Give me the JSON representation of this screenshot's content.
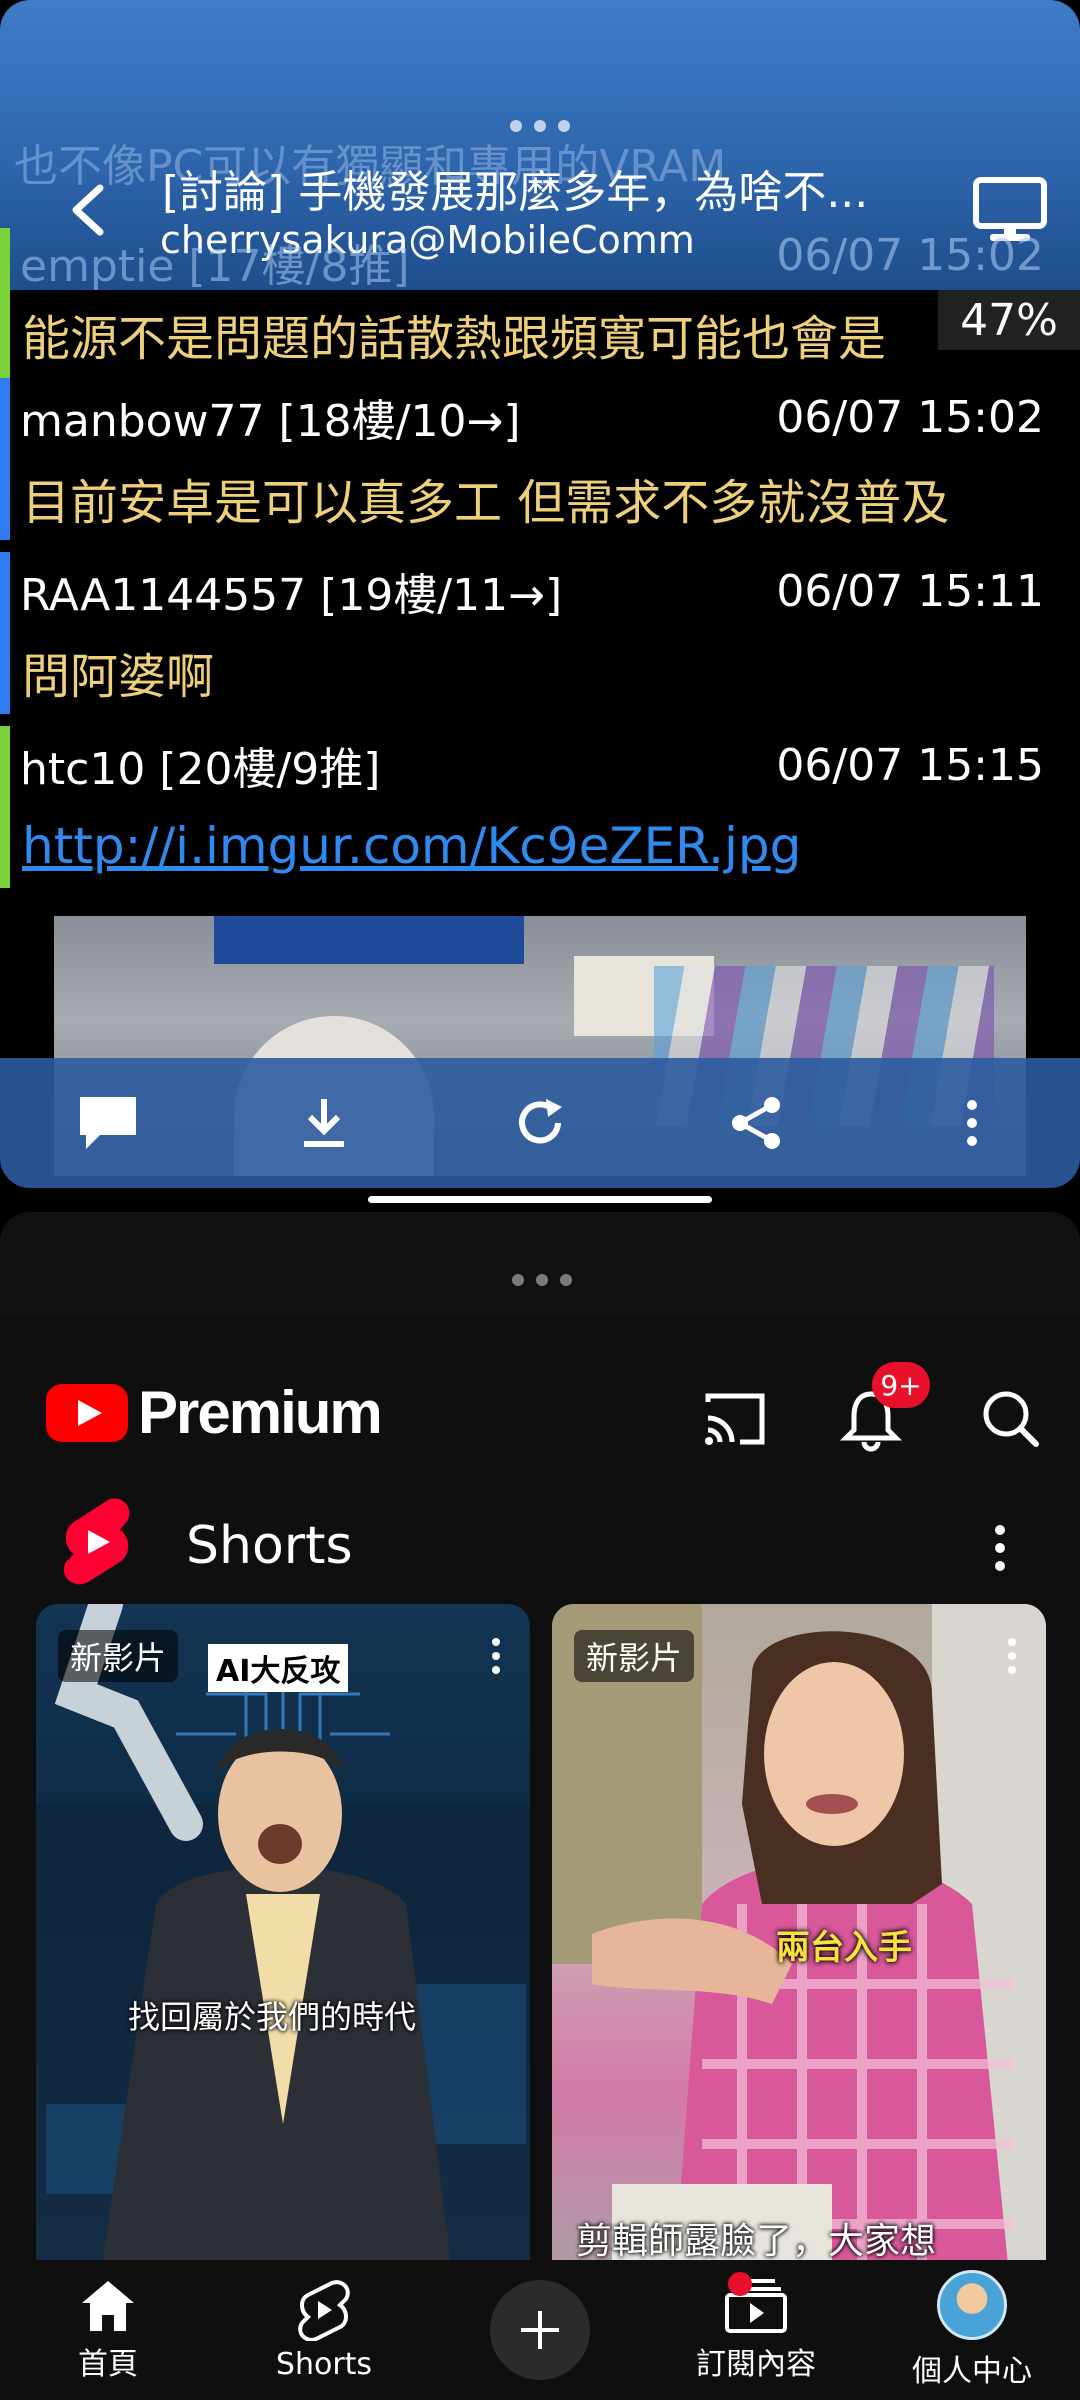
{
  "top_app": {
    "ghost_text": "也不像PC可以有獨顯和專用的VRAM",
    "thread_title": "[討論] 手機發展那麼多年，為啥不...",
    "thread_author": "cherrysakura@MobileComm",
    "progress": "47%",
    "overlay_row": {
      "meta": "emptie [17樓/8推]",
      "time": "06/07 15:02"
    },
    "first_body": "能源不是問題的話散熱跟頻寬可能也會是",
    "posts": [
      {
        "meta": "manbow77 [18樓/10→]",
        "time": "06/07 15:02",
        "body": "目前安卓是可以真多工  但需求不多就沒普及",
        "accent": "#2f7bf0"
      },
      {
        "meta": "RAA1144557 [19樓/11→]",
        "time": "06/07 15:11",
        "body": "問阿婆啊",
        "accent": "#2f7bf0"
      },
      {
        "meta": "htc10 [20樓/9推]",
        "time": "06/07 15:15",
        "body": "http://i.imgur.com/Kc9eZER.jpg",
        "accent": "#7bd33a"
      }
    ]
  },
  "youtube": {
    "brand": "Premium",
    "notification_count": "9+",
    "shelf_title": "Shorts",
    "shorts": [
      {
        "badge": "新影片",
        "tag": "AI大反攻",
        "caption": "找回屬於我們的時代"
      },
      {
        "badge": "新影片",
        "yellow_caption": "兩台入手",
        "caption": "剪輯師露臉了，大家想"
      }
    ],
    "nav": {
      "home": "首頁",
      "shorts": "Shorts",
      "subscriptions": "訂閱內容",
      "profile": "個人中心"
    }
  },
  "colors": {
    "header_blue": "#2f66ad",
    "post_body": "#efd07a",
    "link": "#2f8af0",
    "youtube_red": "#ff0000"
  },
  "icons": {
    "top_toolbar": [
      "comment-icon",
      "download-icon",
      "refresh-icon",
      "share-icon",
      "more-vert-icon"
    ],
    "youtube_header": [
      "cast-icon",
      "bell-icon",
      "search-icon"
    ]
  }
}
